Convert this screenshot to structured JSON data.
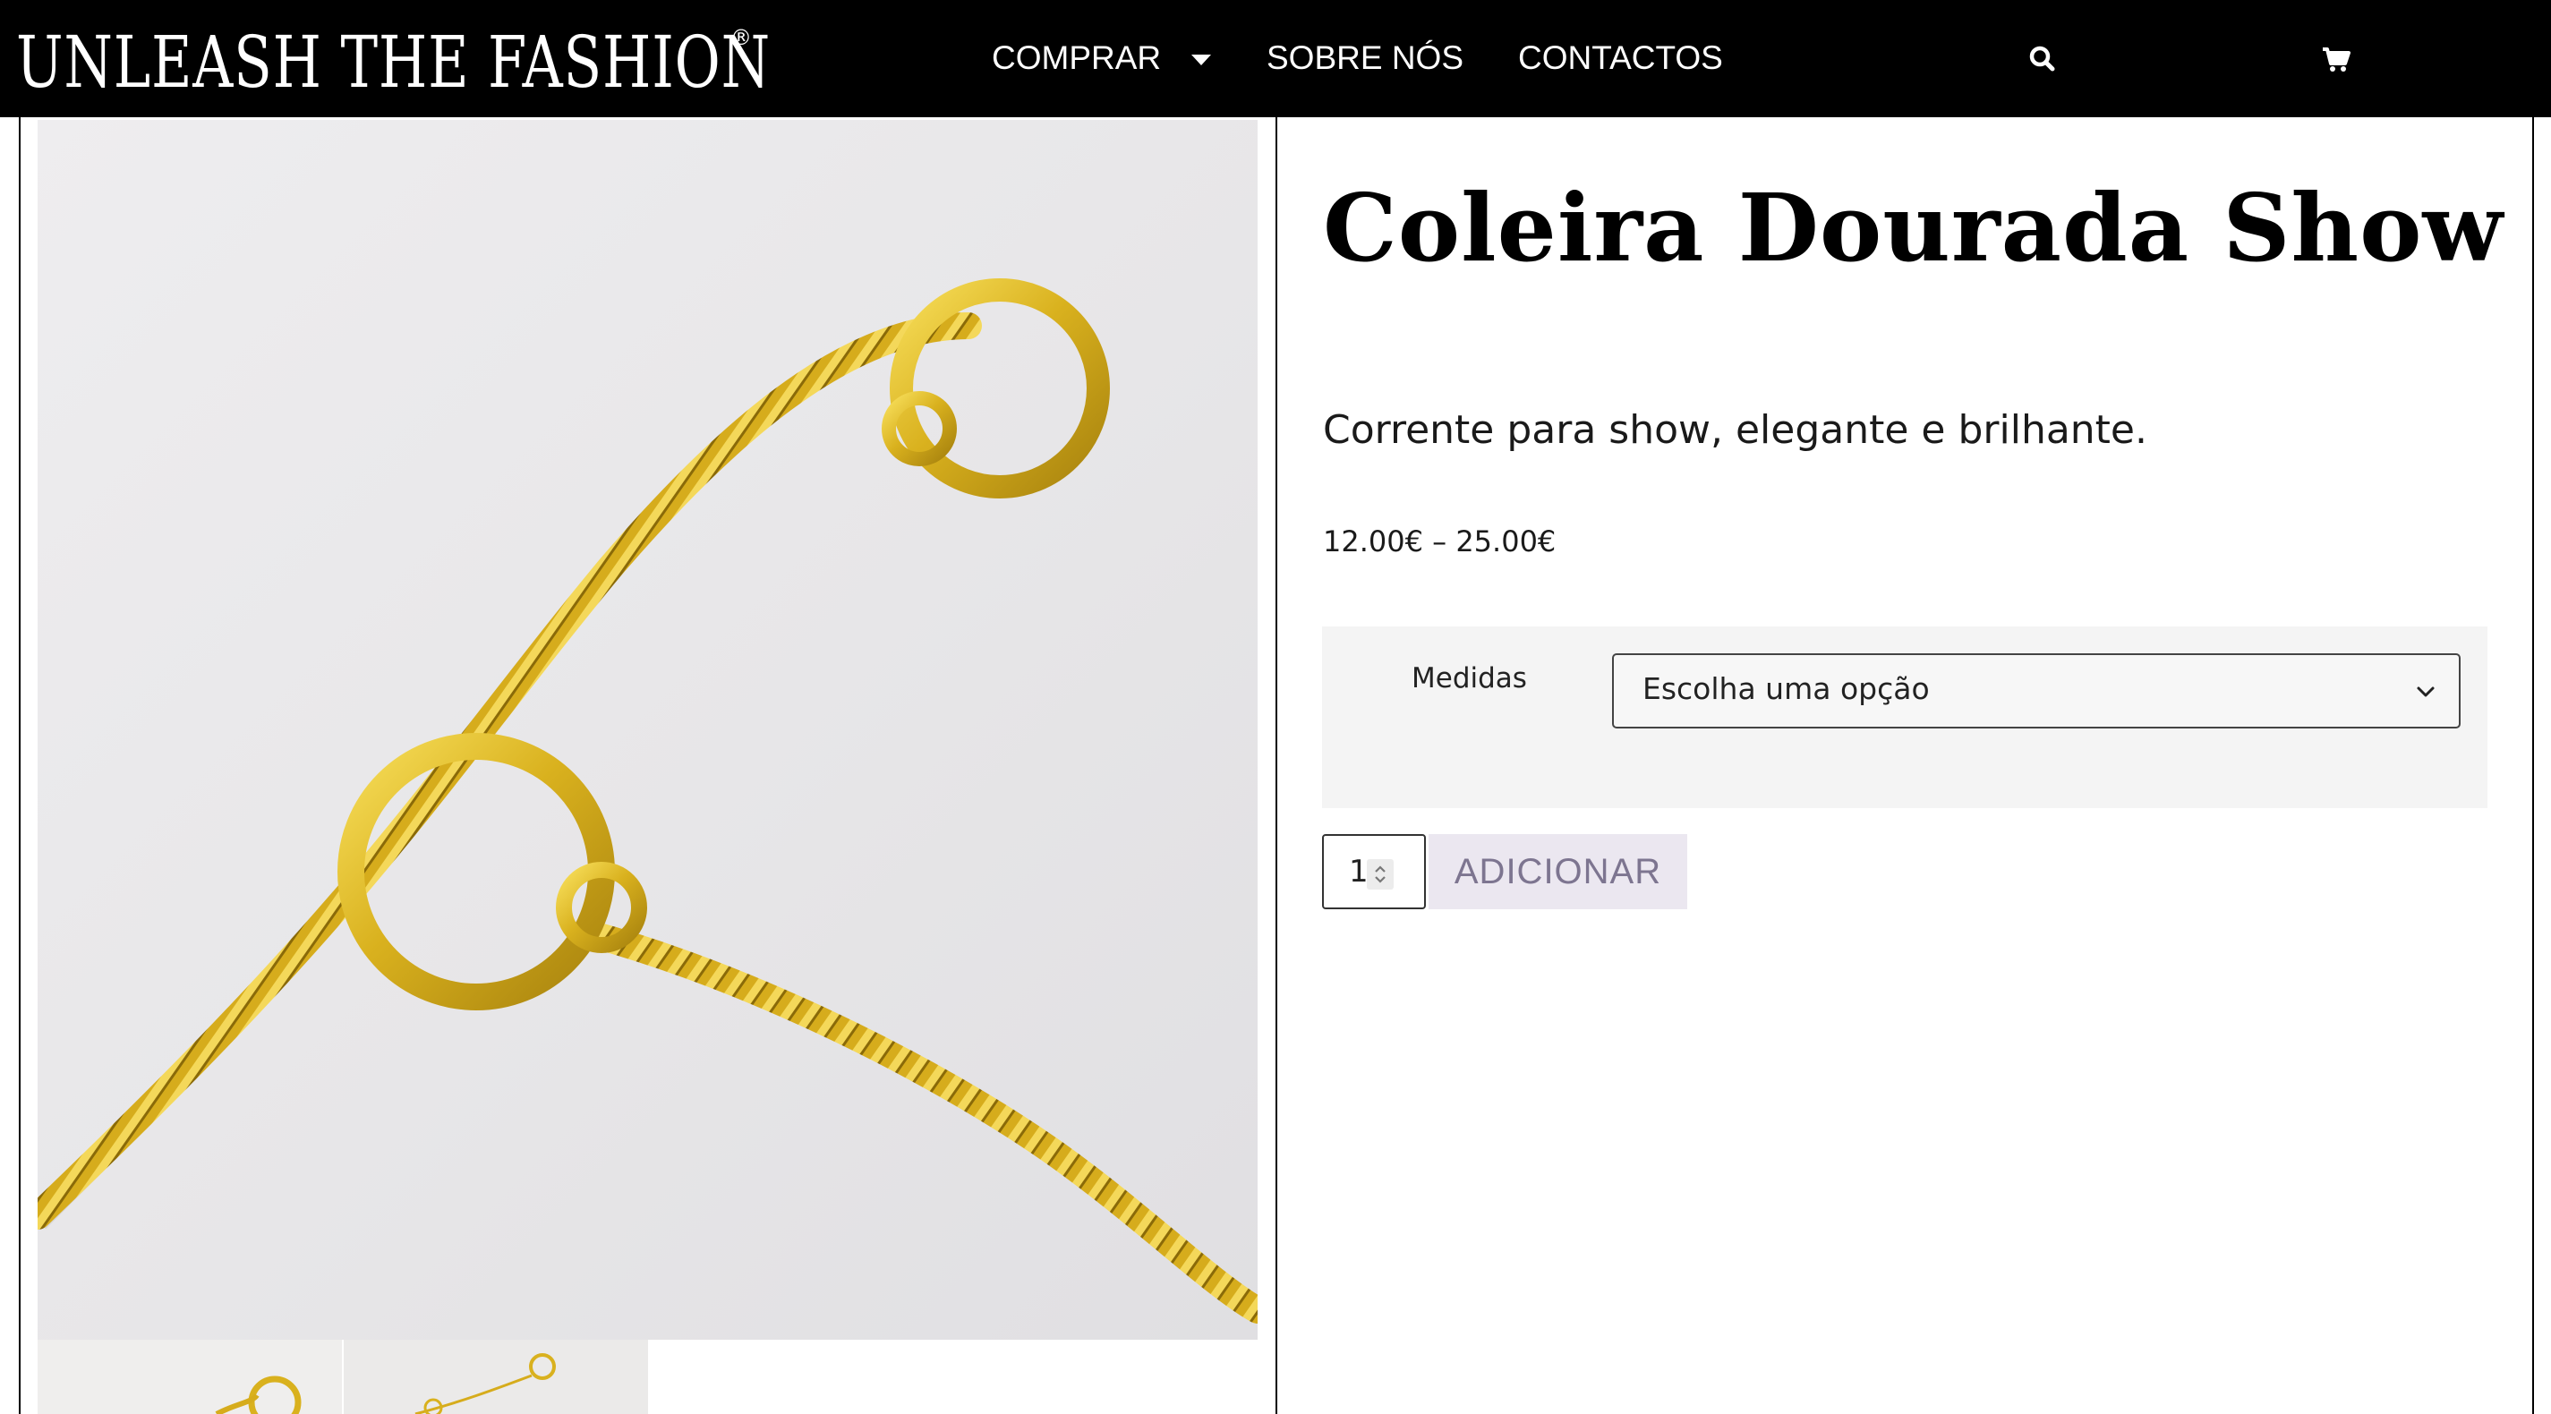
{
  "header": {
    "logo_text": "UNLEASH THE FASHION",
    "logo_mark": "®",
    "nav": [
      {
        "label": "COMPRAR",
        "has_dropdown": true
      },
      {
        "label": "SOBRE NÓS",
        "has_dropdown": false
      },
      {
        "label": "CONTACTOS",
        "has_dropdown": false
      }
    ],
    "icons": {
      "search": "search-icon",
      "cart": "cart-icon"
    }
  },
  "product": {
    "title": "Coleira Dourada Show",
    "short_description": "Corrente para show, elegante e brilhante.",
    "price_range": "12.00€ – 25.00€",
    "variations": {
      "label": "Medidas",
      "selected": "Escolha uma opção"
    },
    "quantity": "1",
    "add_to_cart_label": "ADICIONAR"
  },
  "colors": {
    "header_bg": "#000000",
    "gold": "#d9b11e",
    "button_bg": "#ebe7f0",
    "button_text": "#7d7590",
    "variations_bg": "#f4f4f4"
  }
}
